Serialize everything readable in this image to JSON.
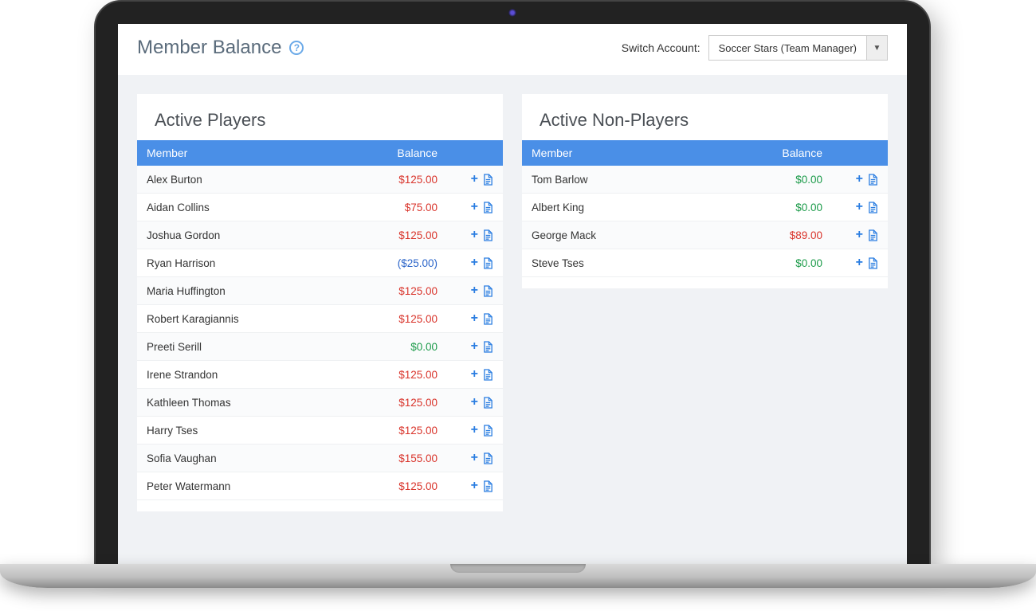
{
  "header": {
    "title": "Member Balance",
    "switch_label": "Switch Account:",
    "account_selected": "Soccer Stars (Team Manager)"
  },
  "tables": {
    "col_member": "Member",
    "col_balance": "Balance"
  },
  "panels": {
    "players": {
      "title": "Active Players",
      "rows": [
        {
          "name": "Alex Burton",
          "balance": "$125.00",
          "status": "positive"
        },
        {
          "name": "Aidan Collins",
          "balance": "$75.00",
          "status": "positive"
        },
        {
          "name": "Joshua Gordon",
          "balance": "$125.00",
          "status": "positive"
        },
        {
          "name": "Ryan Harrison",
          "balance": "($25.00)",
          "status": "negative"
        },
        {
          "name": "Maria Huffington",
          "balance": "$125.00",
          "status": "positive"
        },
        {
          "name": "Robert Karagiannis",
          "balance": "$125.00",
          "status": "positive"
        },
        {
          "name": "Preeti Serill",
          "balance": "$0.00",
          "status": "zero"
        },
        {
          "name": "Irene Strandon",
          "balance": "$125.00",
          "status": "positive"
        },
        {
          "name": "Kathleen Thomas",
          "balance": "$125.00",
          "status": "positive"
        },
        {
          "name": "Harry Tses",
          "balance": "$125.00",
          "status": "positive"
        },
        {
          "name": "Sofia Vaughan",
          "balance": "$155.00",
          "status": "positive"
        },
        {
          "name": "Peter Watermann",
          "balance": "$125.00",
          "status": "positive"
        }
      ]
    },
    "nonplayers": {
      "title": "Active Non-Players",
      "rows": [
        {
          "name": "Tom Barlow",
          "balance": "$0.00",
          "status": "zero"
        },
        {
          "name": "Albert King",
          "balance": "$0.00",
          "status": "zero"
        },
        {
          "name": "George Mack",
          "balance": "$89.00",
          "status": "positive"
        },
        {
          "name": "Steve Tses",
          "balance": "$0.00",
          "status": "zero"
        }
      ]
    }
  }
}
